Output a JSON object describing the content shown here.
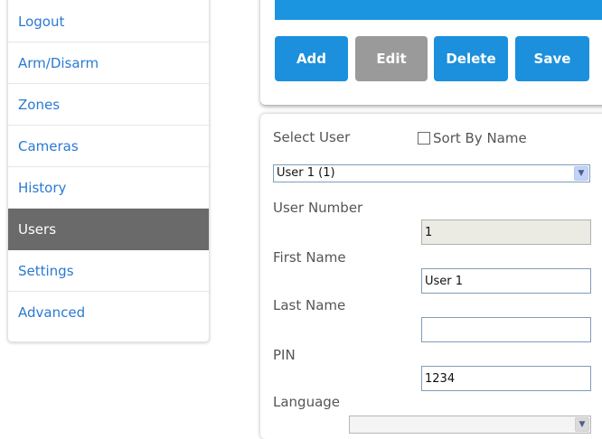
{
  "sidebar": {
    "items": [
      {
        "label": "Logout"
      },
      {
        "label": "Arm/Disarm"
      },
      {
        "label": "Zones"
      },
      {
        "label": "Cameras"
      },
      {
        "label": "History"
      },
      {
        "label": "Users",
        "active": true
      },
      {
        "label": "Settings"
      },
      {
        "label": "Advanced"
      }
    ]
  },
  "toolbar": {
    "add_label": "Add",
    "edit_label": "Edit",
    "delete_label": "Delete",
    "save_label": "Save"
  },
  "form": {
    "select_user_label": "Select User",
    "sort_by_name_label": "Sort By Name",
    "sort_by_name_checked": false,
    "selected_user": "User 1 (1)",
    "user_number_label": "User Number",
    "user_number_value": "1",
    "first_name_label": "First Name",
    "first_name_value": "User 1",
    "last_name_label": "Last Name",
    "last_name_value": "",
    "pin_label": "PIN",
    "pin_value": "1234",
    "language_label": "Language"
  },
  "colors": {
    "accent": "#1c90dc",
    "active_nav": "#6a6a6a",
    "link": "#2a7ad2",
    "disabled_button": "#9a9a9a"
  },
  "icons": {
    "select_arrow": "chevron-down-icon",
    "checkbox": "checkbox-icon"
  }
}
